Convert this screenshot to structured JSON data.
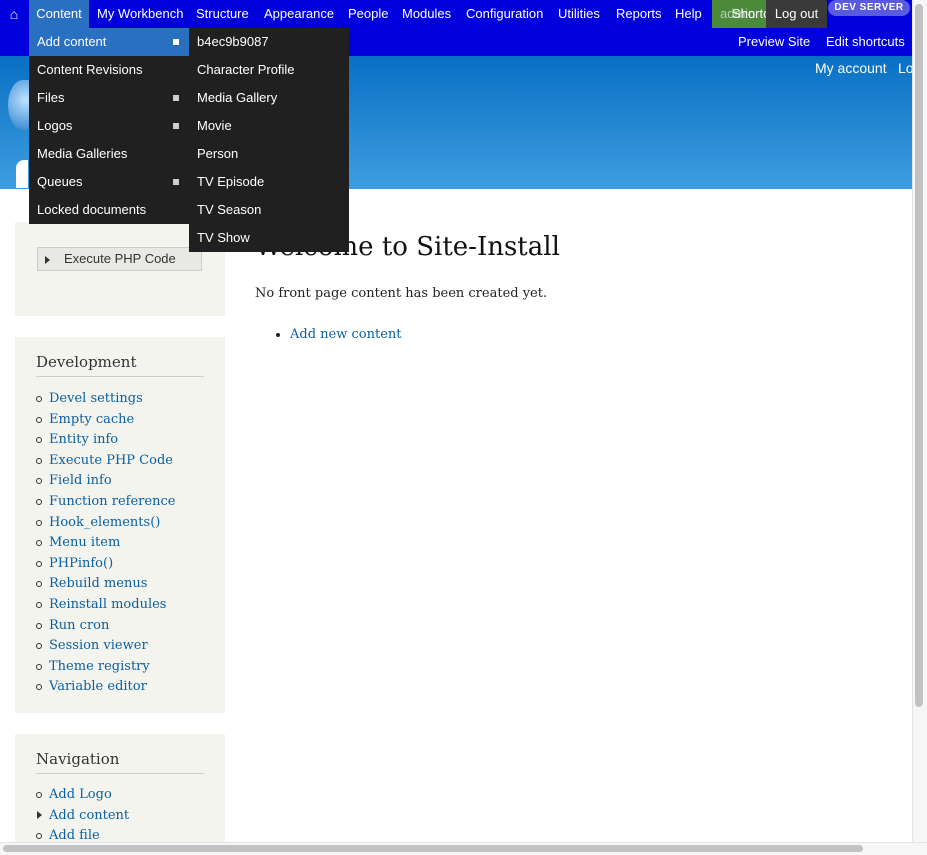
{
  "toolbar": {
    "home_icon": "⌂",
    "items": [
      "Content",
      "My Workbench",
      "Structure",
      "Appearance",
      "People",
      "Modules",
      "Configuration",
      "Utilities",
      "Reports",
      "Help"
    ],
    "overlap_left": "admin",
    "overlap_mid": "Shortcuts",
    "logout": "Log out",
    "dev_badge": "DEV SERVER"
  },
  "shortcuts": {
    "preview_site": "Preview Site",
    "edit_shortcuts": "Edit shortcuts"
  },
  "header": {
    "my_account": "My account",
    "logout_partial": "Lo"
  },
  "content_menu": {
    "items": [
      "Add content",
      "Content Revisions",
      "Files",
      "Logos",
      "Media Galleries",
      "Queues",
      "Locked documents"
    ]
  },
  "add_content_menu": {
    "items": [
      "b4ec9b9087",
      "Character Profile",
      "Media Gallery",
      "Movie",
      "Person",
      "TV Episode",
      "TV Season",
      "TV Show"
    ]
  },
  "sidebar": {
    "execute_php": "Execute PHP Code",
    "development": {
      "title": "Development",
      "links": [
        "Devel settings",
        "Empty cache",
        "Entity info",
        "Execute PHP Code",
        "Field info",
        "Function reference",
        "Hook_elements()",
        "Menu item",
        "PHPinfo()",
        "Rebuild menus",
        "Reinstall modules",
        "Run cron",
        "Session viewer",
        "Theme registry",
        "Variable editor"
      ]
    },
    "navigation": {
      "title": "Navigation",
      "links": [
        "Add Logo",
        "Add content",
        "Add file"
      ]
    }
  },
  "main": {
    "title": "Welcome to Site-Install",
    "message": "No front page content has been created yet.",
    "add_new": "Add new content"
  },
  "colors": {
    "toolbar_bg": "#0000dd",
    "menu_bg": "#202020",
    "highlight": "#2a70c0",
    "link": "#0a5fa0"
  }
}
